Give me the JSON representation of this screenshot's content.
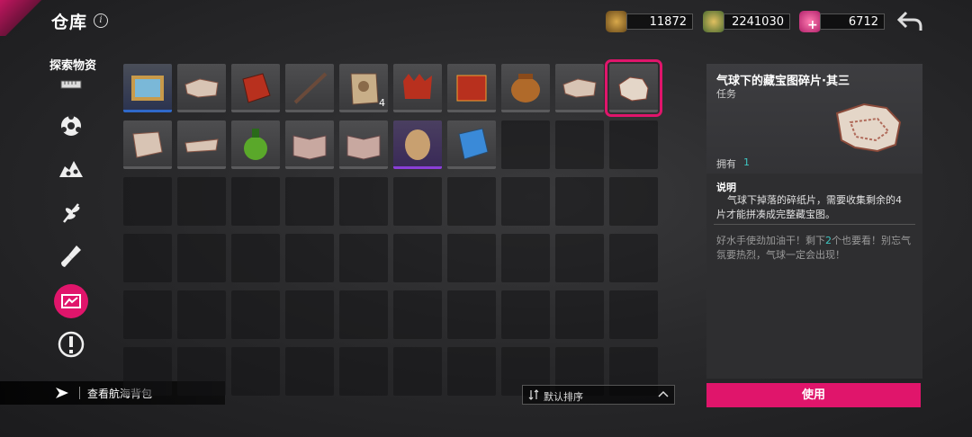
{
  "header": {
    "title": "仓库",
    "info_icon": "i",
    "currencies": [
      {
        "icon": "gold-ore-icon",
        "value": "11872"
      },
      {
        "icon": "coin-stack-icon",
        "value": "2241030"
      },
      {
        "icon": "pink-crystal-icon",
        "value": "6712"
      }
    ],
    "back_icon": "back-arrow-icon"
  },
  "sidebar": {
    "category_title": "探索物资",
    "items": [
      {
        "icon": "ruler-icon",
        "active": false
      },
      {
        "icon": "flower-gear-icon",
        "active": false
      },
      {
        "icon": "rocks-icon",
        "active": false
      },
      {
        "icon": "herb-icon",
        "active": false
      },
      {
        "icon": "shovel-icon",
        "active": false
      },
      {
        "icon": "treasure-map-icon",
        "active": true
      },
      {
        "icon": "alert-icon",
        "active": false
      }
    ],
    "bottom_link": "查看航海背包"
  },
  "inventory": {
    "slots": [
      {
        "item": "framed-painting",
        "rarity": "blue",
        "count": ""
      },
      {
        "item": "paper-scrap",
        "rarity": "gray",
        "count": ""
      },
      {
        "item": "red-cloth",
        "rarity": "gray",
        "count": ""
      },
      {
        "item": "old-sword",
        "rarity": "gray",
        "count": ""
      },
      {
        "item": "face-parchment",
        "rarity": "gray",
        "count": "4"
      },
      {
        "item": "red-crown-cloth",
        "rarity": "gray",
        "count": ""
      },
      {
        "item": "red-banner",
        "rarity": "gray",
        "count": ""
      },
      {
        "item": "clay-pot",
        "rarity": "gray",
        "count": ""
      },
      {
        "item": "paper-scrap",
        "rarity": "gray",
        "count": ""
      },
      {
        "item": "map-fragment-3",
        "rarity": "gray",
        "count": "",
        "selected": true
      },
      {
        "item": "map-fragment",
        "rarity": "gray",
        "count": ""
      },
      {
        "item": "paper-strip",
        "rarity": "gray",
        "count": ""
      },
      {
        "item": "green-potion",
        "rarity": "gray",
        "count": ""
      },
      {
        "item": "open-book",
        "rarity": "gray",
        "count": ""
      },
      {
        "item": "open-book",
        "rarity": "gray",
        "count": ""
      },
      {
        "item": "egg",
        "rarity": "purple",
        "count": ""
      },
      {
        "item": "blue-tablet",
        "rarity": "gray",
        "count": ""
      }
    ],
    "sort_icon": "sort-icon",
    "sort_label": "默认排序"
  },
  "detail": {
    "name": "气球下的藏宝图碎片·其三",
    "type": "任务",
    "owned_label": "拥有",
    "owned_value": "1",
    "desc_title": "说明",
    "desc_text": "气球下掉落的碎纸片，需要收集剩余的4片才能拼凑成完整藏宝图。",
    "flavor_before": "好水手使劲加油干！剩下",
    "flavor_highlight": "2",
    "flavor_after": "个也要看！别忘气氛要热烈，气球一定会出现！",
    "use_button": "使用"
  },
  "colors": {
    "accent": "#e0156b",
    "teal": "#3ec6c2",
    "rarity_blue": "#2f69c9",
    "rarity_purple": "#8b3fd8"
  }
}
